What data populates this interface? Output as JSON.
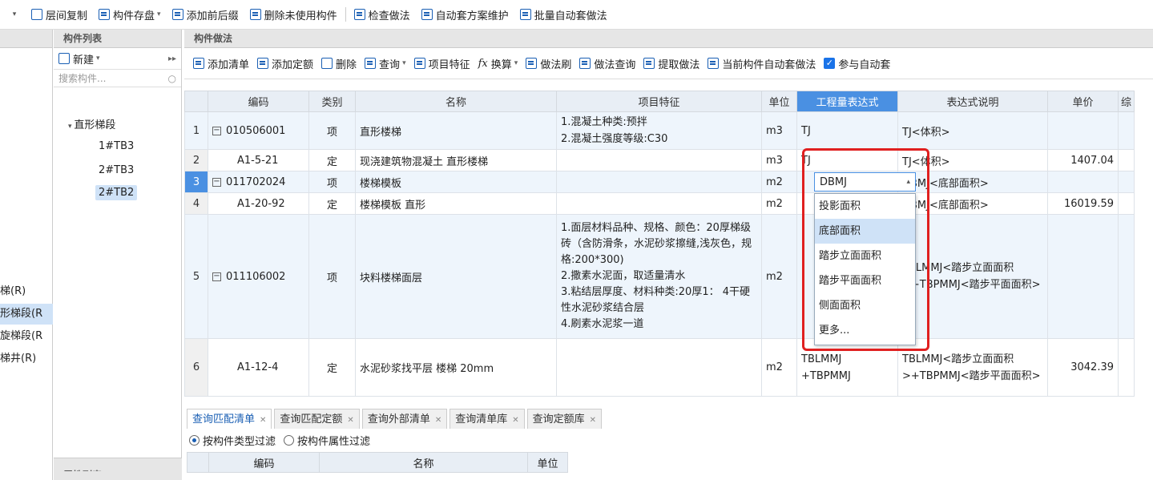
{
  "toolbar": {
    "items": [
      {
        "label": "层间复制",
        "icon": "copy-floor-icon"
      },
      {
        "label": "构件存盘",
        "icon": "save-component-icon",
        "dropdown": true
      },
      {
        "label": "添加前后缀",
        "icon": "add-affix-icon"
      },
      {
        "label": "删除未使用构件",
        "icon": "delete-unused-icon"
      },
      {
        "label": "检查做法",
        "icon": "check-method-icon"
      },
      {
        "label": "自动套方案维护",
        "icon": "auto-scheme-icon"
      },
      {
        "label": "批量自动套做法",
        "icon": "batch-auto-icon"
      }
    ]
  },
  "left_nav": {
    "items": [
      {
        "label": "梯(R)",
        "selected": false
      },
      {
        "label": "形梯段(R",
        "selected": true
      },
      {
        "label": "旋梯段(R",
        "selected": false
      },
      {
        "label": "梯井(R)",
        "selected": false
      }
    ]
  },
  "component_list": {
    "title": "构件列表",
    "new_label": "新建",
    "search_placeholder": "搜索构件...",
    "tree_root": "直形梯段",
    "tree_items": [
      {
        "label": "1#TB3",
        "selected": false
      },
      {
        "label": "2#TB3",
        "selected": false
      },
      {
        "label": "2#TB2",
        "selected": true
      }
    ]
  },
  "attr_list": {
    "title": "属性列表"
  },
  "method_panel": {
    "title": "构件做法",
    "toolbar": [
      {
        "label": "添加清单",
        "icon": "add-list-icon"
      },
      {
        "label": "添加定额",
        "icon": "add-quota-icon"
      },
      {
        "label": "删除",
        "icon": "trash-icon"
      },
      {
        "label": "查询",
        "icon": "query-icon",
        "dropdown": true
      },
      {
        "label": "项目特征",
        "icon": "feature-icon"
      },
      {
        "label": "换算",
        "icon": "fx-icon",
        "dropdown": true
      },
      {
        "label": "做法刷",
        "icon": "brush-icon"
      },
      {
        "label": "做法查询",
        "icon": "method-query-icon"
      },
      {
        "label": "提取做法",
        "icon": "extract-icon"
      },
      {
        "label": "当前构件自动套做法",
        "icon": "auto-apply-icon"
      }
    ],
    "auto_checkbox_label": "参与自动套",
    "auto_checked": true
  },
  "grid": {
    "columns": [
      "",
      "编码",
      "类别",
      "名称",
      "项目特征",
      "单位",
      "工程量表达式",
      "表达式说明",
      "单价",
      "综"
    ],
    "rows": [
      {
        "num": "1",
        "code": "010506001",
        "cat": "项",
        "name": "直形楼梯",
        "feature": "1.混凝土种类:预拌\n2.混凝土强度等级:C30",
        "unit": "m3",
        "expr": "TJ",
        "desc": "TJ<体积>",
        "price": "",
        "expand": true
      },
      {
        "num": "2",
        "code": "A1-5-21",
        "cat": "定",
        "name": "现浇建筑物混凝土 直形楼梯",
        "feature": "",
        "unit": "m3",
        "expr": "TJ",
        "desc": "TJ<体积>",
        "price": "1407.04",
        "expand": false
      },
      {
        "num": "3",
        "code": "011702024",
        "cat": "项",
        "name": "楼梯模板",
        "feature": "",
        "unit": "m2",
        "expr": "DBMJ",
        "desc": "DBMJ<底部面积>",
        "price": "",
        "expand": true
      },
      {
        "num": "4",
        "code": "A1-20-92",
        "cat": "定",
        "name": "楼梯模板 直形",
        "feature": "",
        "unit": "m2",
        "expr": "",
        "desc": "DBMJ<底部面积>",
        "price": "16019.59",
        "expand": false
      },
      {
        "num": "5",
        "code": "011106002",
        "cat": "项",
        "name": "块料楼梯面层",
        "feature": "1.面层材料品种、规格、颜色：20厚梯级砖（含防滑条，水泥砂浆擦缝,浅灰色，规格:200*300)\n2.撒素水泥面，取适量清水\n3.粘结层厚度、材料种类:20厚1： 4干硬性水泥砂浆结合层\n4.刷素水泥浆一道",
        "unit": "m2",
        "expr": "",
        "desc": "TBLMMJ<踏步立面面积>+TBPMMJ<踏步平面面积>",
        "price": "",
        "expand": true
      },
      {
        "num": "6",
        "code": "A1-12-4",
        "cat": "定",
        "name": "水泥砂浆找平层 楼梯 20mm",
        "feature": "",
        "unit": "m2",
        "expr": "TBLMMJ\n+TBPMMJ",
        "desc": "TBLMMJ<踏步立面面积>+TBPMMJ<踏步平面面积>",
        "price": "3042.39",
        "expand": false
      }
    ]
  },
  "combo": {
    "value": "DBMJ"
  },
  "dropdown": {
    "options": [
      "投影面积",
      "底部面积",
      "踏步立面面积",
      "踏步平面面积",
      "侧面面积",
      "更多..."
    ],
    "highlighted": "底部面积"
  },
  "bottom_tabs": [
    "查询匹配清单",
    "查询匹配定额",
    "查询外部清单",
    "查询清单库",
    "查询定额库"
  ],
  "filter": {
    "opt1": "按构件类型过滤",
    "opt2": "按构件属性过滤"
  },
  "sub_grid": {
    "columns": [
      "",
      "编码",
      "名称",
      "单位"
    ]
  },
  "colors": {
    "accent": "#4a90e2",
    "highlight": "#e02020"
  }
}
